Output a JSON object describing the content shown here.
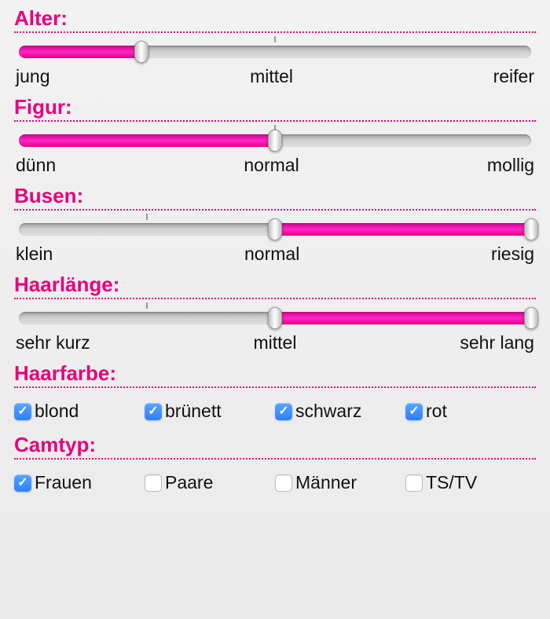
{
  "sliders": [
    {
      "key": "alter",
      "title": "Alter:",
      "labels": [
        "jung",
        "mittel",
        "reifer"
      ],
      "fill_start": 0,
      "fill_end": 24,
      "handle1": 24,
      "handle2": null,
      "tick": 50
    },
    {
      "key": "figur",
      "title": "Figur:",
      "labels": [
        "dünn",
        "normal",
        "mollig"
      ],
      "fill_start": 0,
      "fill_end": 50,
      "handle1": 50,
      "handle2": null,
      "tick": 50
    },
    {
      "key": "busen",
      "title": "Busen:",
      "labels": [
        "klein",
        "normal",
        "riesig"
      ],
      "fill_start": 50,
      "fill_end": 100,
      "handle1": 50,
      "handle2": 100,
      "tick": 25
    },
    {
      "key": "haarlaenge",
      "title": "Haarlänge:",
      "labels": [
        "sehr kurz",
        "mittel",
        "sehr lang"
      ],
      "fill_start": 50,
      "fill_end": 100,
      "handle1": 50,
      "handle2": 100,
      "tick": 25
    }
  ],
  "haarfarbe": {
    "title": "Haarfarbe:",
    "options": [
      {
        "label": "blond",
        "checked": true
      },
      {
        "label": "brünett",
        "checked": true
      },
      {
        "label": "schwarz",
        "checked": true
      },
      {
        "label": "rot",
        "checked": true
      }
    ]
  },
  "camtyp": {
    "title": "Camtyp:",
    "options": [
      {
        "label": "Frauen",
        "checked": true
      },
      {
        "label": "Paare",
        "checked": false
      },
      {
        "label": "Männer",
        "checked": false
      },
      {
        "label": "TS/TV",
        "checked": false
      }
    ]
  }
}
